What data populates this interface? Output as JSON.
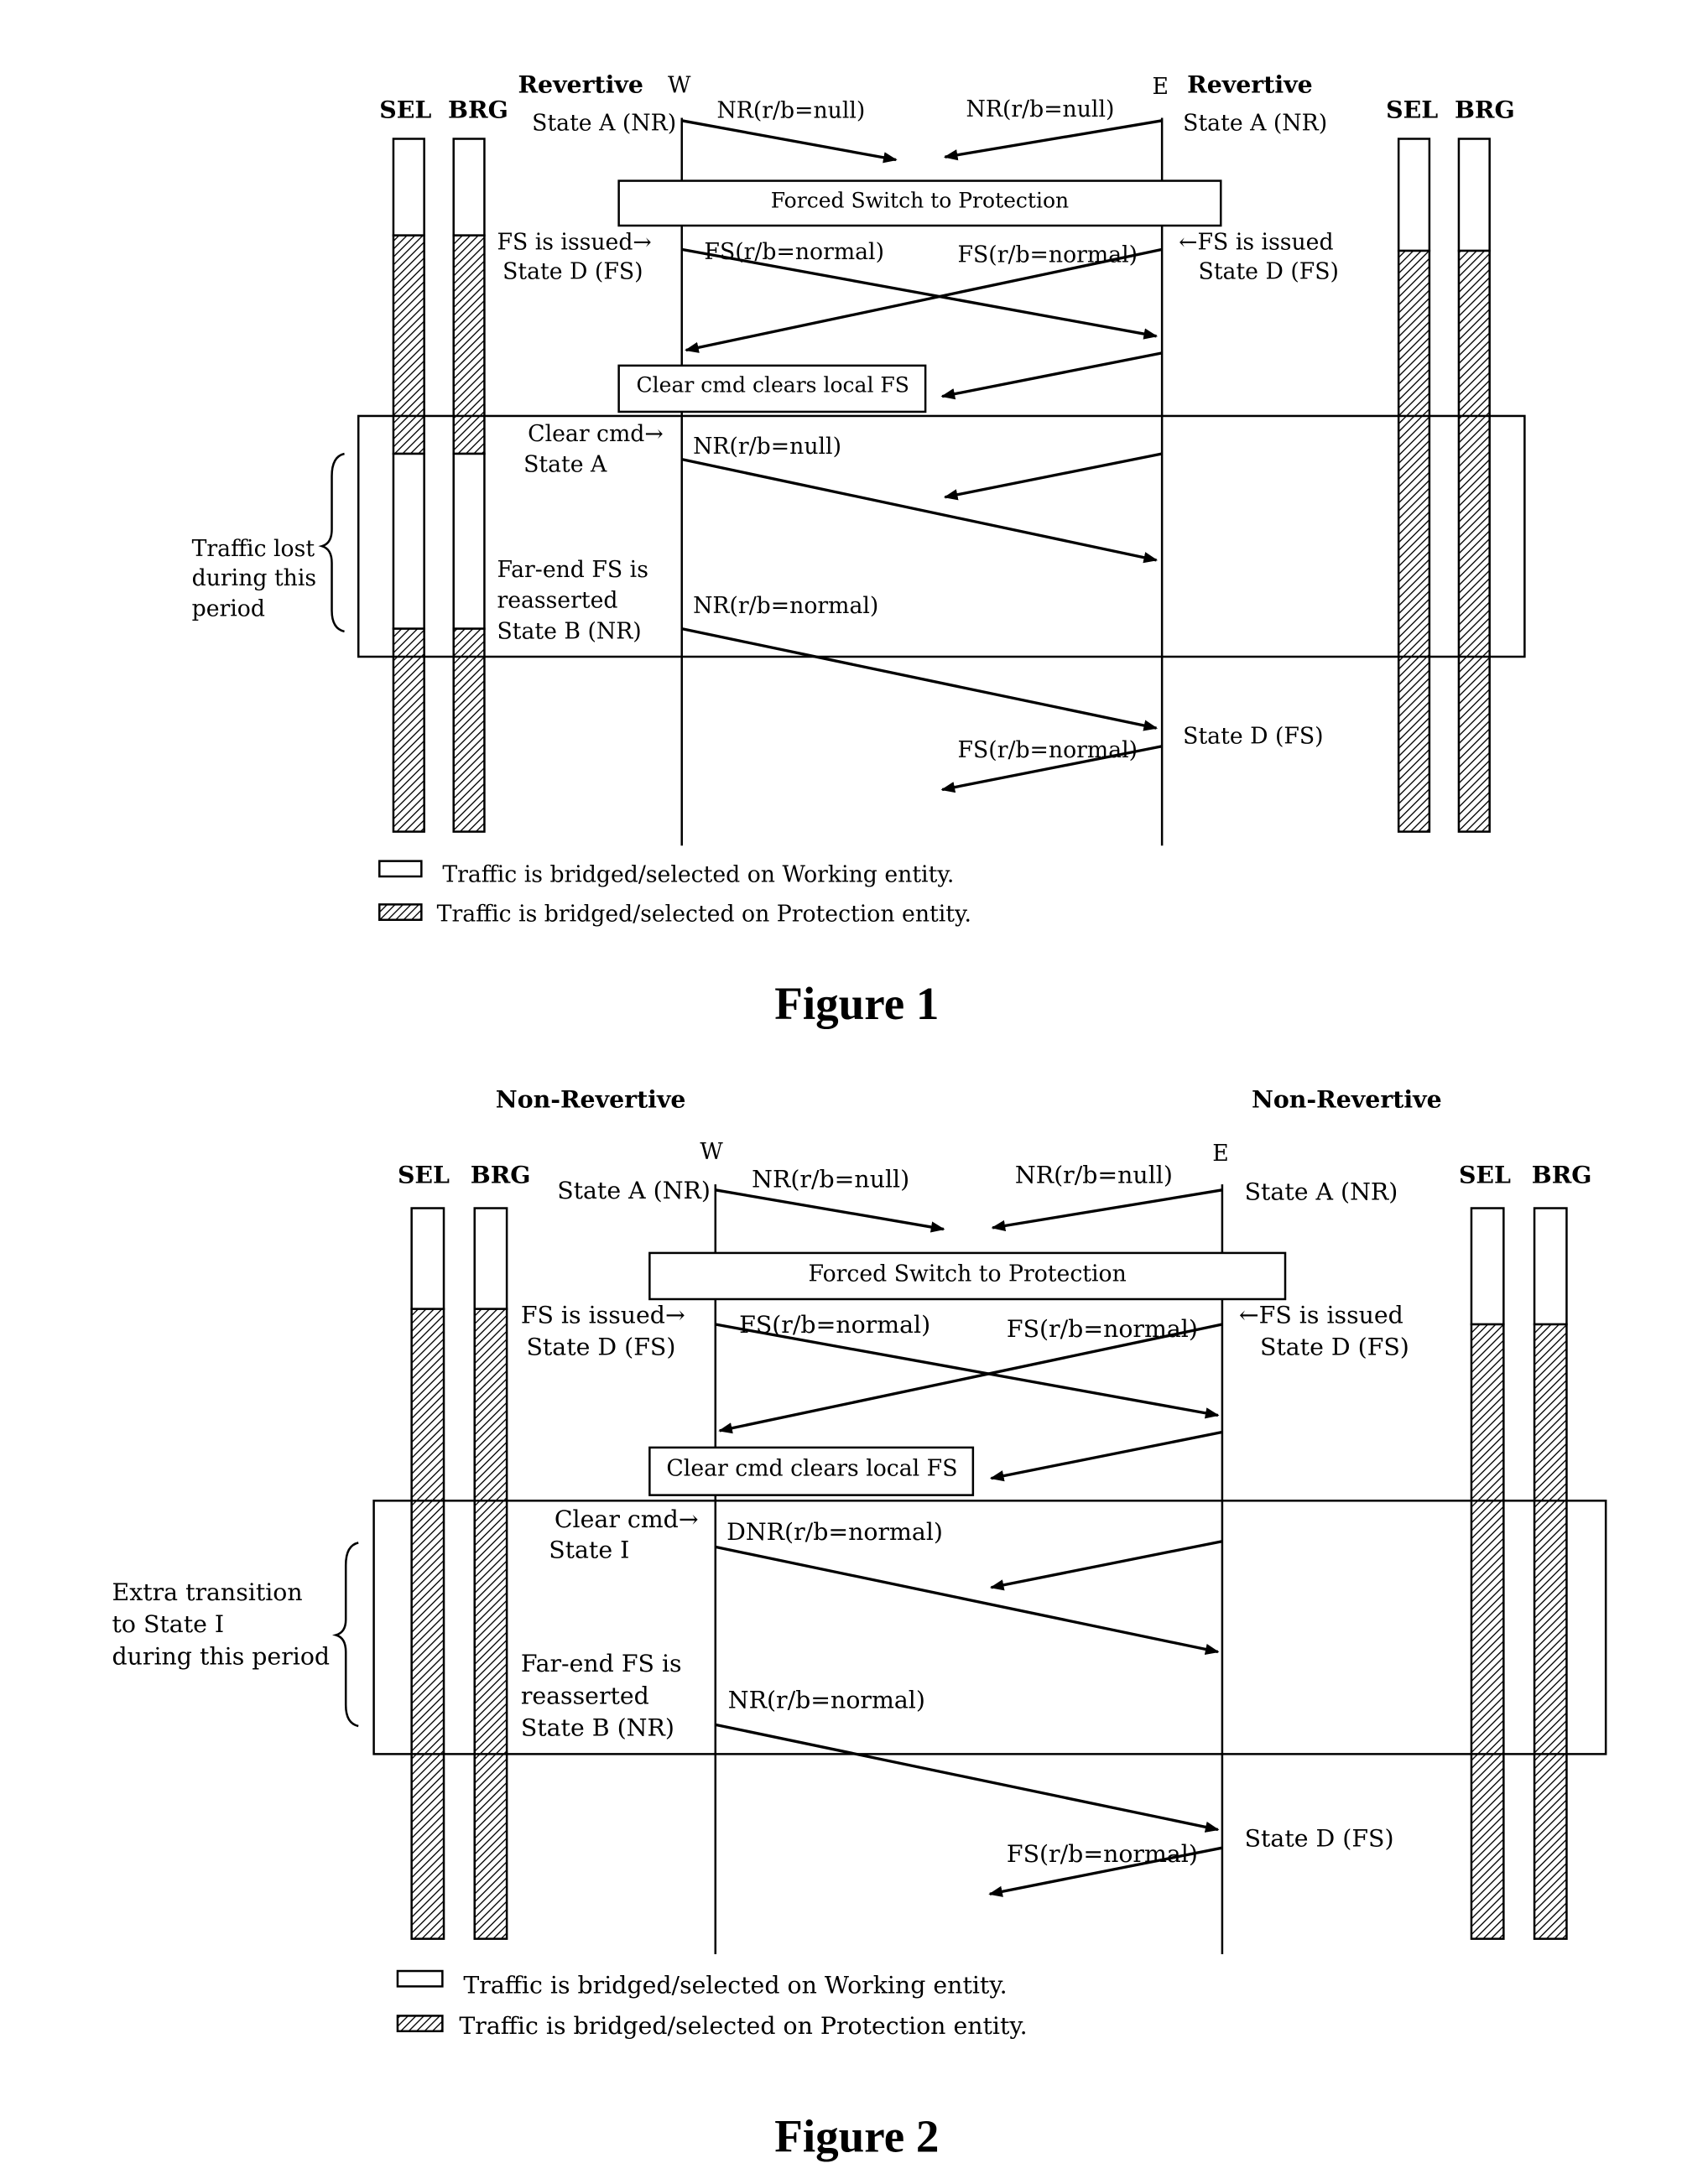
{
  "figures": [
    {
      "title": "Figure 1",
      "left_mode": "Revertive",
      "right_mode": "Revertive",
      "left_node": "W",
      "right_node": "E",
      "sel_label": "SEL",
      "brg_label": "BRG",
      "left_states": {
        "s1": "State A (NR)",
        "s2a": "FS is issued→",
        "s2b": "State D (FS)",
        "s3a": "Clear cmd→",
        "s3b": "State A",
        "s4a": "Far-end FS is",
        "s4b": "reasserted",
        "s4c": "State B (NR)"
      },
      "right_states": {
        "s1": "State A (NR)",
        "s2a": "←FS is issued",
        "s2b": "State D (FS)",
        "s3": "State D (FS)"
      },
      "messages": {
        "m1": "NR(r/b=null)",
        "m2": "NR(r/b=null)",
        "m3": "FS(r/b=normal)",
        "m4": "FS(r/b=normal)",
        "m5": "NR(r/b=null)",
        "m6": "NR(r/b=normal)",
        "m7": "FS(r/b=normal)"
      },
      "boxes": {
        "forced": "Forced Switch to Protection",
        "clear": "Clear cmd clears local FS"
      },
      "brace_note": [
        "Traffic lost",
        "during this",
        "period"
      ],
      "legend": {
        "working": "Traffic is bridged/selected on Working entity.",
        "protection": "Traffic is bridged/selected on Protection entity."
      }
    },
    {
      "title": "Figure 2",
      "left_mode": "Non-Revertive",
      "right_mode": "Non-Revertive",
      "left_node": "W",
      "right_node": "E",
      "sel_label": "SEL",
      "brg_label": "BRG",
      "left_states": {
        "s1": "State A (NR)",
        "s2a": "FS is issued→",
        "s2b": "State D (FS)",
        "s3a": "Clear cmd→",
        "s3b": "State I",
        "s4a": "Far-end FS is",
        "s4b": "reasserted",
        "s4c": "State B (NR)"
      },
      "right_states": {
        "s1": "State A (NR)",
        "s2a": "←FS is issued",
        "s2b": "State D (FS)",
        "s3": "State D (FS)"
      },
      "messages": {
        "m1": "NR(r/b=null)",
        "m2": "NR(r/b=null)",
        "m3": "FS(r/b=normal)",
        "m4": "FS(r/b=normal)",
        "m5": "DNR(r/b=normal)",
        "m6": "NR(r/b=normal)",
        "m7": "FS(r/b=normal)"
      },
      "boxes": {
        "forced": "Forced Switch to Protection",
        "clear": "Clear cmd clears local FS"
      },
      "brace_note": [
        "Extra transition",
        "to State I",
        "during this period"
      ],
      "legend": {
        "working": "Traffic is bridged/selected on Working entity.",
        "protection": "Traffic is bridged/selected on Protection entity."
      }
    }
  ]
}
